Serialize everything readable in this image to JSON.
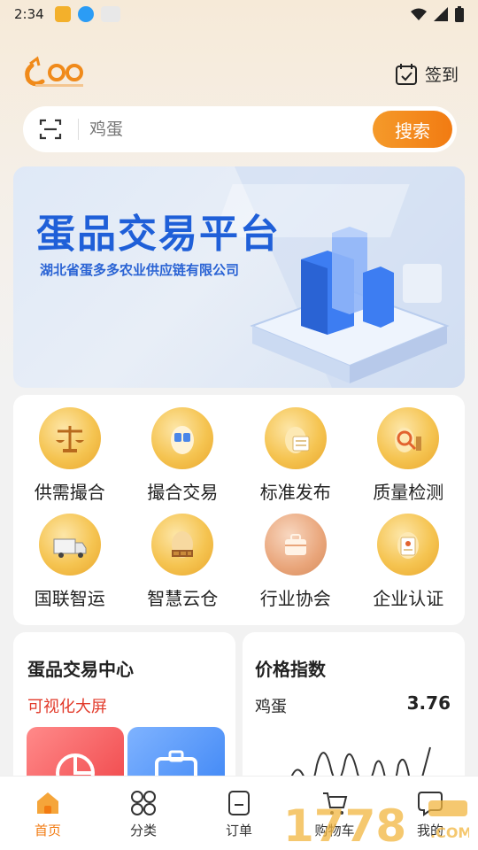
{
  "status": {
    "time": "2:34"
  },
  "header": {
    "checkin_label": "签到"
  },
  "search": {
    "placeholder": "鸡蛋",
    "button_label": "搜索"
  },
  "banner": {
    "title": "蛋品交易平台",
    "subtitle": "湖北省蛋多多农业供应链有限公司"
  },
  "services": [
    {
      "label": "供需撮合",
      "icon": "scale-icon"
    },
    {
      "label": "撮合交易",
      "icon": "handshake-icon"
    },
    {
      "label": "标准发布",
      "icon": "document-icon"
    },
    {
      "label": "质量检测",
      "icon": "microscope-icon"
    },
    {
      "label": "国联智运",
      "icon": "truck-icon"
    },
    {
      "label": "智慧云仓",
      "icon": "warehouse-icon"
    },
    {
      "label": "行业协会",
      "icon": "briefcase-icon"
    },
    {
      "label": "企业认证",
      "icon": "certificate-icon"
    }
  ],
  "trade_center": {
    "title": "蛋品交易中心",
    "link": "可视化大屏"
  },
  "price_index": {
    "title": "价格指数",
    "item": "鸡蛋",
    "value": "3.76"
  },
  "tabs": [
    {
      "label": "首页",
      "icon": "home-icon",
      "active": true
    },
    {
      "label": "分类",
      "icon": "grid-icon",
      "active": false
    },
    {
      "label": "订单",
      "icon": "order-icon",
      "active": false
    },
    {
      "label": "购物车",
      "icon": "cart-icon",
      "active": false
    },
    {
      "label": "我的",
      "icon": "profile-icon",
      "active": false
    }
  ],
  "colors": {
    "accent": "#f27b12",
    "banner_blue": "#1f5fd8",
    "link_red": "#e23a2a"
  }
}
